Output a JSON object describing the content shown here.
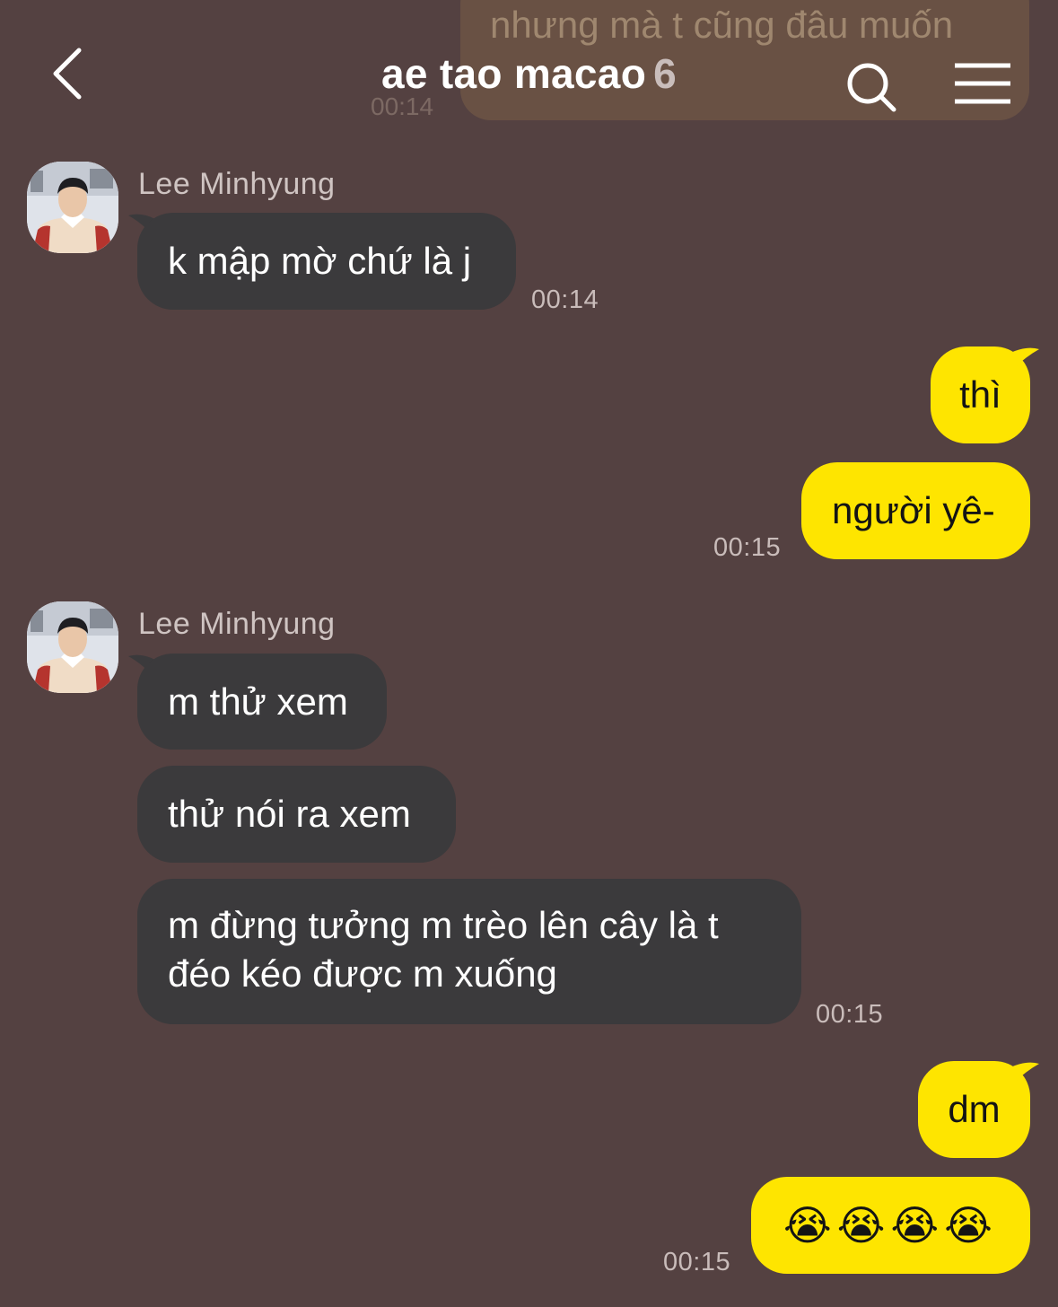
{
  "ghost_message": {
    "text": "nhưng mà t cũng đâu muốn",
    "time": "00:14"
  },
  "header": {
    "title": "ae tao macao",
    "member_count": "6",
    "back_icon": "chevron-left-icon",
    "search_icon": "search-icon",
    "menu_icon": "hamburger-menu-icon"
  },
  "colors": {
    "background": "#544141",
    "incoming_bubble": "#3b3a3c",
    "outgoing_bubble": "#fee500"
  },
  "messages": [
    {
      "sender": "Lee Minhyung",
      "text": "k mập mờ chứ là j",
      "time": "00:14"
    },
    {
      "text": "thì"
    },
    {
      "text": "người yê-",
      "time": "00:15"
    },
    {
      "sender": "Lee Minhyung",
      "text": "m thử xem"
    },
    {
      "text": "thử nói ra xem"
    },
    {
      "text": "m đừng tưởng m trèo lên cây là t đéo kéo được m xuống",
      "time": "00:15"
    },
    {
      "text": "dm"
    },
    {
      "text": "😭😭😭😭",
      "time": "00:15"
    }
  ]
}
